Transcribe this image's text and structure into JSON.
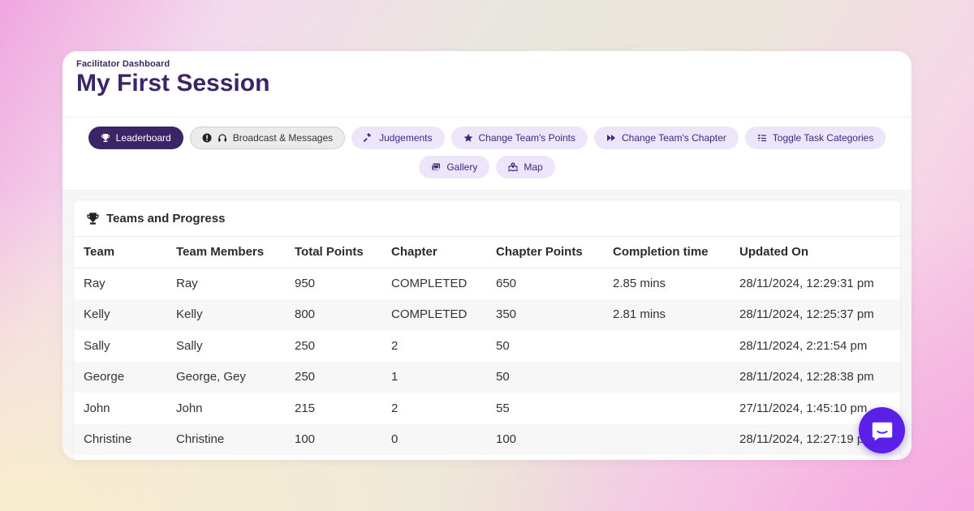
{
  "header": {
    "eyebrow": "Facilitator Dashboard",
    "title": "My First Session"
  },
  "nav": {
    "row1": [
      {
        "label": "Leaderboard",
        "icon": "trophy-icon",
        "state": "active"
      },
      {
        "label": "Broadcast & Messages",
        "icon": "headset-icon",
        "state": "grey"
      },
      {
        "label": "Judgements",
        "icon": "gavel-icon",
        "state": "default"
      },
      {
        "label": "Change Team's Points",
        "icon": "star-icon",
        "state": "default"
      },
      {
        "label": "Change Team's Chapter",
        "icon": "fast-forward-icon",
        "state": "default"
      },
      {
        "label": "Toggle Task Categories",
        "icon": "list-check-icon",
        "state": "default"
      }
    ],
    "row2": [
      {
        "label": "Gallery",
        "icon": "gallery-icon",
        "state": "default"
      },
      {
        "label": "Map",
        "icon": "map-icon",
        "state": "default"
      }
    ]
  },
  "panel": {
    "title": "Teams and Progress",
    "columns": [
      "Team",
      "Team Members",
      "Total Points",
      "Chapter",
      "Chapter Points",
      "Completion time",
      "Updated On"
    ],
    "rows": [
      [
        "Ray",
        "Ray",
        "950",
        "COMPLETED",
        "650",
        "2.85 mins",
        "28/11/2024, 12:29:31 pm"
      ],
      [
        "Kelly",
        "Kelly",
        "800",
        "COMPLETED",
        "350",
        "2.81 mins",
        "28/11/2024, 12:25:37 pm"
      ],
      [
        "Sally",
        "Sally",
        "250",
        "2",
        "50",
        "",
        "28/11/2024, 2:21:54 pm"
      ],
      [
        "George",
        "George, Gey",
        "250",
        "1",
        "50",
        "",
        "28/11/2024, 12:28:38 pm"
      ],
      [
        "John",
        "John",
        "215",
        "2",
        "55",
        "",
        "27/11/2024, 1:45:10 pm"
      ],
      [
        "Christine",
        "Christine",
        "100",
        "0",
        "100",
        "",
        "28/11/2024, 12:27:19 pm"
      ]
    ]
  },
  "colors": {
    "primary": "#3b2566",
    "pill_bg": "#ede6fb",
    "chat": "#5a20e8"
  }
}
